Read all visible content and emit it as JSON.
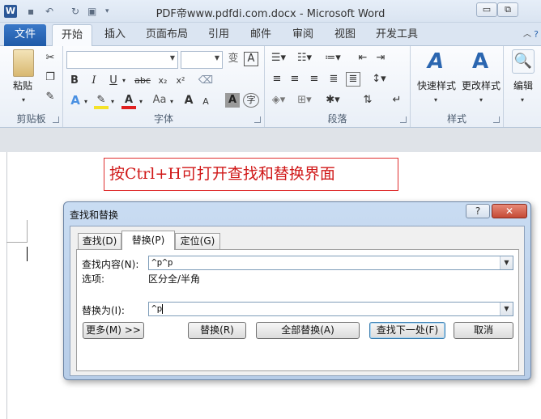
{
  "window": {
    "title": "PDF帝www.pdfdi.com.docx  -  Microsoft Word",
    "app_icon": "W",
    "controls": {
      "minimize": "▭",
      "restore": "⧉"
    }
  },
  "ribbon_tabs": {
    "file": "文件",
    "home": "开始",
    "insert": "插入",
    "layout": "页面布局",
    "references": "引用",
    "mailings": "邮件",
    "review": "审阅",
    "view": "视图",
    "developer": "开发工具"
  },
  "ribbon": {
    "clipboard": {
      "paste_label": "粘贴",
      "group": "剪贴板"
    },
    "font": {
      "group": "字体",
      "bold": "B",
      "italic": "I",
      "underline": "U",
      "strike": "abc",
      "subscript": "x₂",
      "superscript": "x²",
      "phonetic": "变",
      "border_char": "A",
      "grow": "A",
      "shrink": "A",
      "change_case": "Aa",
      "enclose": "字"
    },
    "paragraph": {
      "group": "段落"
    },
    "styles": {
      "group": "样式",
      "quick_styles": "快速样式",
      "change_styles": "更改样式"
    },
    "editing": {
      "label": "编辑"
    }
  },
  "document": {
    "annotation": "按Ctrl+H可打开查找和替换界面"
  },
  "dialog": {
    "title": "查找和替换",
    "help": "?",
    "close": "✕",
    "tabs": {
      "find": "查找(D)",
      "replace": "替换(P)",
      "goto": "定位(G)"
    },
    "find_label": "查找内容(N):",
    "find_value": "^p^p",
    "options_label": "选项:",
    "options_value": "区分全/半角",
    "replace_label": "替换为(I):",
    "replace_value": "^p",
    "buttons": {
      "more": "更多(M) >>",
      "replace": "替换(R)",
      "replace_all": "全部替换(A)",
      "find_next": "查找下一处(F)",
      "cancel": "取消"
    }
  },
  "colors": {
    "accent": "#1e5aa8",
    "annotation_red": "#d01818"
  }
}
